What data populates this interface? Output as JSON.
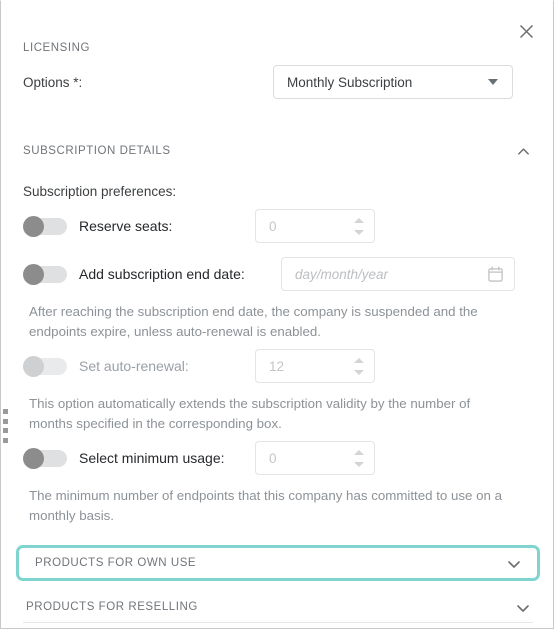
{
  "window": {
    "close_icon": "close-icon"
  },
  "licensing": {
    "heading": "LICENSING",
    "options_label": "Options *:",
    "selected_option": "Monthly Subscription",
    "dropdown_icon": "chevron-down-icon"
  },
  "subscription_details": {
    "heading": "SUBSCRIPTION DETAILS",
    "collapse_icon": "chevron-up-icon",
    "expanded": true,
    "preferences_label": "Subscription preferences:",
    "rows": [
      {
        "label": "Reserve seats:",
        "toggle_state": "off",
        "disabled": false,
        "input_type": "number",
        "input_value": "0"
      },
      {
        "label": "Add subscription end date:",
        "toggle_state": "off",
        "disabled": false,
        "input_type": "date",
        "input_placeholder": "day/month/year",
        "calendar_icon": "calendar-icon",
        "helper_text": "After reaching the subscription end date, the company is suspended and the endpoints expire, unless auto-renewal is enabled."
      },
      {
        "label": "Set auto-renewal:",
        "toggle_state": "off",
        "disabled": true,
        "input_type": "number",
        "input_value": "12",
        "helper_text": "This option automatically extends the subscription validity by the number of months specified in the corresponding box."
      },
      {
        "label": "Select minimum usage:",
        "toggle_state": "off",
        "disabled": false,
        "input_type": "number",
        "input_value": "0",
        "helper_text": "The minimum number of endpoints that this company has committed to use on a monthly basis."
      }
    ]
  },
  "accordions": [
    {
      "label": "PRODUCTS FOR OWN USE",
      "expand_icon": "chevron-down-icon",
      "highlighted": true,
      "highlight_color": "#7fd4cf"
    },
    {
      "label": "PRODUCTS FOR RESELLING",
      "expand_icon": "chevron-down-icon",
      "highlighted": false
    }
  ]
}
